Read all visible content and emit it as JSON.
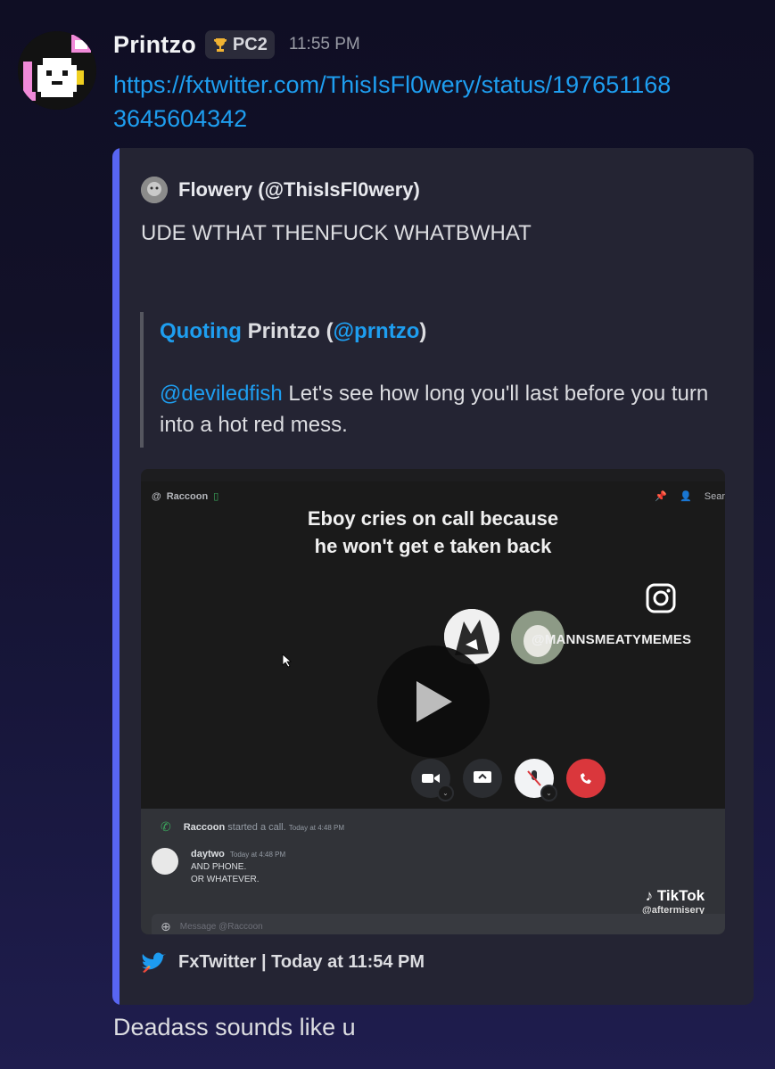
{
  "message": {
    "username": "Printzo",
    "tag": "PC2",
    "tag_icon": "trophy-icon",
    "timestamp": "11:55 PM",
    "link": "https://fxtwitter.com/ThisIsFl0wery/status/1976511683645604342",
    "reply_text": "Deadass sounds like u"
  },
  "embed": {
    "accent_color": "#5865f2",
    "author": "Flowery (@ThisIsFl0wery)",
    "description": "UDE WTHAT THENFUCK WHATBWHAT",
    "quote": {
      "prefix": "Quoting",
      "name": "Printzo (",
      "handle": "@prntzo",
      "suffix": ")",
      "mention": "@deviledfish",
      "text": " Let's see how long you'll last before you turn into a hot red mess."
    },
    "video": {
      "call_name": "Raccoon",
      "top_right": "Sear",
      "caption_line1": "Eboy cries on call because",
      "caption_line2": "he won't get e taken back",
      "watermark": "@MANNSMEATYMEMES",
      "chat_started": "Raccoon",
      "chat_started_rest": "started a call.",
      "chat_started_time": "Today at 4:48 PM",
      "chat_user": "daytwo",
      "chat_user_time": "Today at 4:48 PM",
      "chat_line1": "AND PHONE.",
      "chat_line2": "OR WHATEVER.",
      "chat_input_placeholder": "Message @Raccoon",
      "tiktok_label": "TikTok",
      "tiktok_handle": "@aftermisery"
    },
    "footer": "FxTwitter | Today at 11:54 PM"
  }
}
